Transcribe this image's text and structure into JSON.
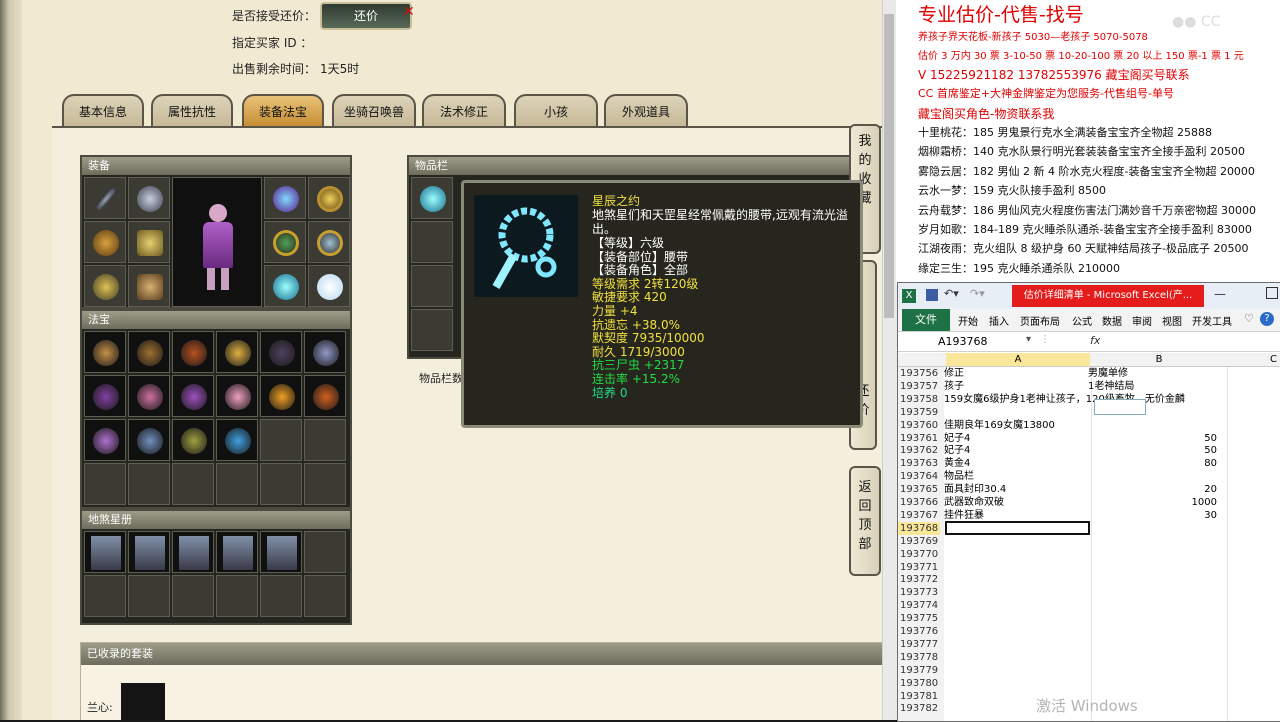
{
  "game": {
    "accept_bargain_label": "是否接受还价：",
    "bargain_button": "还价",
    "buyer_id_label": "指定买家 ID ：",
    "remaining_label": "出售剩余时间：",
    "remaining_value": "1天5时",
    "tabs": [
      "基本信息",
      "属性抗性",
      "装备法宝",
      "坐骑召唤兽",
      "法术修正",
      "小孩",
      "外观道具"
    ],
    "active_tab": "装备法宝",
    "sections": {
      "equipment": "装备",
      "treasure": "法宝",
      "star_book": "地煞星册",
      "inventory": "物品栏",
      "inventory_footer": "物品栏数",
      "collected_sets": "已收录的套装",
      "lanxin": "兰心:"
    },
    "side_buttons": {
      "my_collection": "我的收藏",
      "bargain": "还价",
      "back_to_top": "返回顶部"
    }
  },
  "tooltip": {
    "name": "星辰之约",
    "desc1": "地煞星们和天罡星经常佩戴的腰带,远观有流光溢",
    "desc2": "出。",
    "lines": [
      {
        "text": "【等级】六级",
        "color": "#ffffff"
      },
      {
        "text": "【装备部位】腰带",
        "color": "#ffffff"
      },
      {
        "text": "【装备角色】全部",
        "color": "#ffffff"
      },
      {
        "text": "等级需求 2转120级",
        "color": "#f0e040"
      },
      {
        "text": "敏捷要求 420",
        "color": "#f0e040"
      },
      {
        "text": "力量 +4",
        "color": "#f0e040"
      },
      {
        "text": "抗遗忘 +38.0%",
        "color": "#f0e040"
      },
      {
        "text": "默契度 7935/10000",
        "color": "#f0e040"
      },
      {
        "text": "耐久 1719/3000",
        "color": "#f0e040"
      },
      {
        "text": "抗三尸虫 +2317",
        "color": "#22dd44"
      },
      {
        "text": "连击率 +15.2%",
        "color": "#22dd44"
      },
      {
        "text": "培养 0",
        "color": "#22dd88"
      }
    ]
  },
  "notes": {
    "title": "专业估价-代售-找号",
    "lines": [
      {
        "text": "养孩子界天花板-新孩子 5030—老孩子 5070-5078",
        "red": true
      },
      {
        "text": "估价 3 万内 30 票 3-10-50 票 10-20-100 票 20 以上 150 票-1 票 1 元",
        "red": true
      },
      {
        "text": "V 15225921182      13782553976    藏宝阁买号联系",
        "red": true
      },
      {
        "text": "CC 首席鉴定+大神金牌鉴定为您服务-代售组号-单号",
        "red": true
      },
      {
        "text": "藏宝阁买角色-物资联系我",
        "red": true
      },
      {
        "text": "十里桃花：185 男鬼景行克水全满装备宝宝齐全物超 25888",
        "red": false
      },
      {
        "text": "烟柳霜桥：140 克水队景行明光套装装备宝宝齐全接手盈利 20500",
        "red": false
      },
      {
        "text": "雾隐云居：182 男仙 2 新 4 阶水克火程度-装备宝宝齐全物超 20000",
        "red": false
      },
      {
        "text": "云水一梦：159 克火队接手盈利 8500",
        "red": false
      },
      {
        "text": "云舟载梦：186 男仙风克火程度伤害法门满妙音千万亲密物超 30000",
        "red": false
      },
      {
        "text": "岁月如歌：184-189 克火睡杀队通杀-装备宝宝齐全接手盈利 83000",
        "red": false
      },
      {
        "text": "江湖夜雨：克火组队 8 级护身 60 天赋神结局孩子-极品底子 20500",
        "red": false
      },
      {
        "text": "缘定三生：195 克火睡杀通杀队 210000",
        "red": false
      }
    ]
  },
  "excel": {
    "title": "估价详细清单 - Microsoft Excel(产...",
    "menu": [
      "文件",
      "开始",
      "插入",
      "页面布局",
      "公式",
      "数据",
      "审阅",
      "视图",
      "开发工具"
    ],
    "name_box": "A193768",
    "fx": "fx",
    "columns": [
      "A",
      "B",
      "C"
    ],
    "rows": [
      {
        "n": "193756",
        "a": "修正",
        "b": "男魔单修",
        "num": ""
      },
      {
        "n": "193757",
        "a": "孩子",
        "b": "1老神结局",
        "num": ""
      },
      {
        "n": "193758",
        "a": "159女魔6级护身1老神让孩子，120级畜牧，无价金麟",
        "b": "",
        "num": ""
      },
      {
        "n": "193759",
        "a": "",
        "b": "",
        "num": ""
      },
      {
        "n": "193760",
        "a": "佳期良年169女魔13800",
        "b": "",
        "num": ""
      },
      {
        "n": "193761",
        "a": "妃子4",
        "b": "",
        "num": "50"
      },
      {
        "n": "193762",
        "a": "妃子4",
        "b": "",
        "num": "50"
      },
      {
        "n": "193763",
        "a": "黄金4",
        "b": "",
        "num": "80"
      },
      {
        "n": "193764",
        "a": "物品栏",
        "b": "",
        "num": ""
      },
      {
        "n": "193765",
        "a": "面具封印30.4",
        "b": "",
        "num": "20"
      },
      {
        "n": "193766",
        "a": "武器致命双破",
        "b": "",
        "num": "1000"
      },
      {
        "n": "193767",
        "a": "挂件狂暴",
        "b": "",
        "num": "30"
      },
      {
        "n": "193768",
        "a": "",
        "b": "",
        "num": ""
      },
      {
        "n": "193769",
        "a": "",
        "b": "",
        "num": ""
      },
      {
        "n": "193770",
        "a": "",
        "b": "",
        "num": ""
      },
      {
        "n": "193771",
        "a": "",
        "b": "",
        "num": ""
      },
      {
        "n": "193772",
        "a": "",
        "b": "",
        "num": ""
      },
      {
        "n": "193773",
        "a": "",
        "b": "",
        "num": ""
      },
      {
        "n": "193774",
        "a": "",
        "b": "",
        "num": ""
      },
      {
        "n": "193775",
        "a": "",
        "b": "",
        "num": ""
      },
      {
        "n": "193776",
        "a": "",
        "b": "",
        "num": ""
      },
      {
        "n": "193777",
        "a": "",
        "b": "",
        "num": ""
      },
      {
        "n": "193778",
        "a": "",
        "b": "",
        "num": ""
      },
      {
        "n": "193779",
        "a": "",
        "b": "",
        "num": ""
      },
      {
        "n": "193780",
        "a": "",
        "b": "",
        "num": ""
      },
      {
        "n": "193781",
        "a": "",
        "b": "",
        "num": ""
      },
      {
        "n": "193782",
        "a": "",
        "b": "",
        "num": ""
      }
    ],
    "watermark": "激活 Windows"
  }
}
